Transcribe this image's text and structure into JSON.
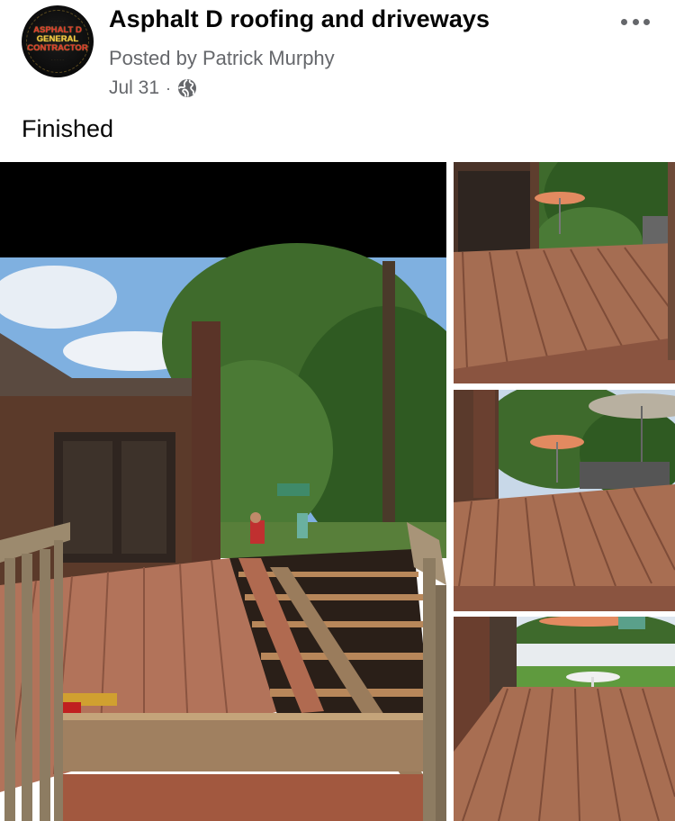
{
  "post": {
    "page_name": "Asphalt D roofing and driveways",
    "posted_by": "Posted by Patrick Murphy",
    "date": "Jul 31",
    "separator": "·",
    "privacy_icon": "globe-icon",
    "more_icon": "more-horizontal-icon",
    "text": "Finished"
  },
  "avatar": {
    "logo_lines": [
      "ASPHALT D",
      "GENERAL",
      "CONTRACTOR"
    ]
  },
  "photos": [
    {
      "name": "deck-under-construction-photo"
    },
    {
      "name": "finished-deck-photo-1"
    },
    {
      "name": "finished-deck-photo-2"
    },
    {
      "name": "finished-deck-photo-3"
    }
  ]
}
